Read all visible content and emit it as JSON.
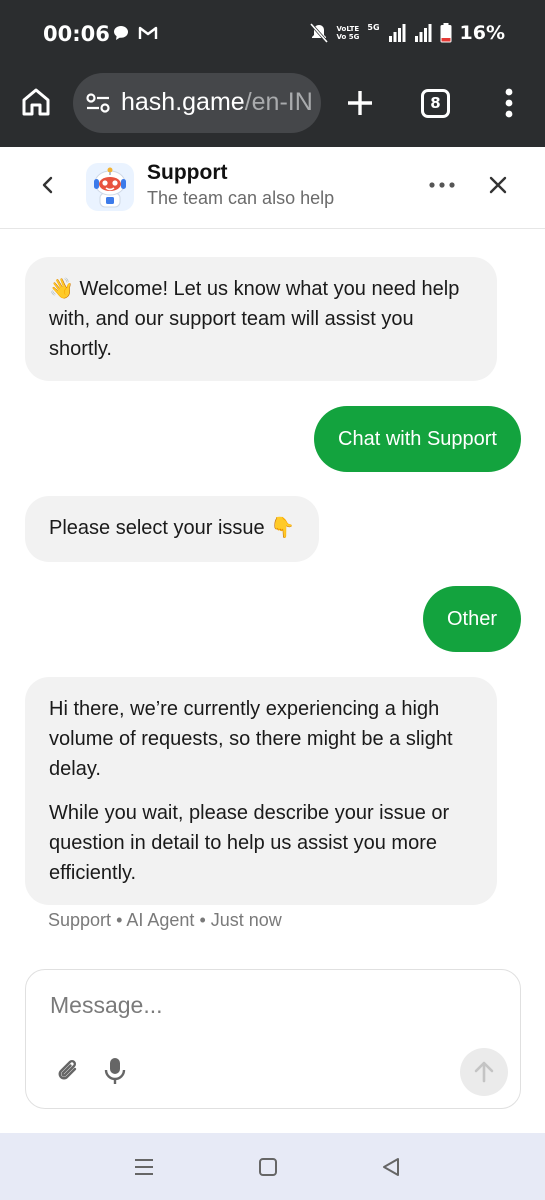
{
  "status_bar": {
    "time": "00:06",
    "volte_line1": "VoLTE",
    "volte_line2": "Vo 5G",
    "network": "5G",
    "battery_pct": "16%"
  },
  "browser": {
    "url_host": "hash.game",
    "url_path": "/en-IN",
    "tab_count": "8"
  },
  "chat_header": {
    "title": "Support",
    "subtitle": "The team can also help"
  },
  "messages": [
    {
      "from": "bot",
      "text": "👋 Welcome! Let us know what you need help with, and our support team will assist you shortly."
    },
    {
      "from": "user",
      "text": "Chat with Support"
    },
    {
      "from": "bot",
      "text": "Please select your issue 👇"
    },
    {
      "from": "user",
      "text": "Other"
    },
    {
      "from": "bot",
      "paragraphs": [
        "Hi there, we’re currently experiencing a high volume of requests, so there might be a slight delay.",
        "While you wait, please describe your issue or question in detail to help us assist you more efficiently."
      ]
    }
  ],
  "meta": {
    "sender": "Support",
    "role": "AI Agent",
    "time": "Just now"
  },
  "composer": {
    "placeholder": "Message..."
  },
  "colors": {
    "accent_green": "#13a33e",
    "bot_bubble": "#f2f2f2",
    "browser_bg": "#2b2d2f",
    "nav_bar": "#e7eaf6"
  },
  "icons": {
    "status": [
      "chat-bubble-icon",
      "gmail-icon",
      "mute-icon",
      "signal-icon",
      "battery-icon"
    ],
    "browser": [
      "home-icon",
      "site-settings-icon",
      "plus-icon",
      "kebab-menu-icon"
    ],
    "header": [
      "chevron-left-icon",
      "robot-avatar-icon",
      "more-dots-icon",
      "close-icon"
    ],
    "composer": [
      "paperclip-icon",
      "microphone-icon",
      "arrow-up-icon"
    ],
    "nav": [
      "recents-icon",
      "home-square-icon",
      "back-triangle-icon"
    ]
  }
}
